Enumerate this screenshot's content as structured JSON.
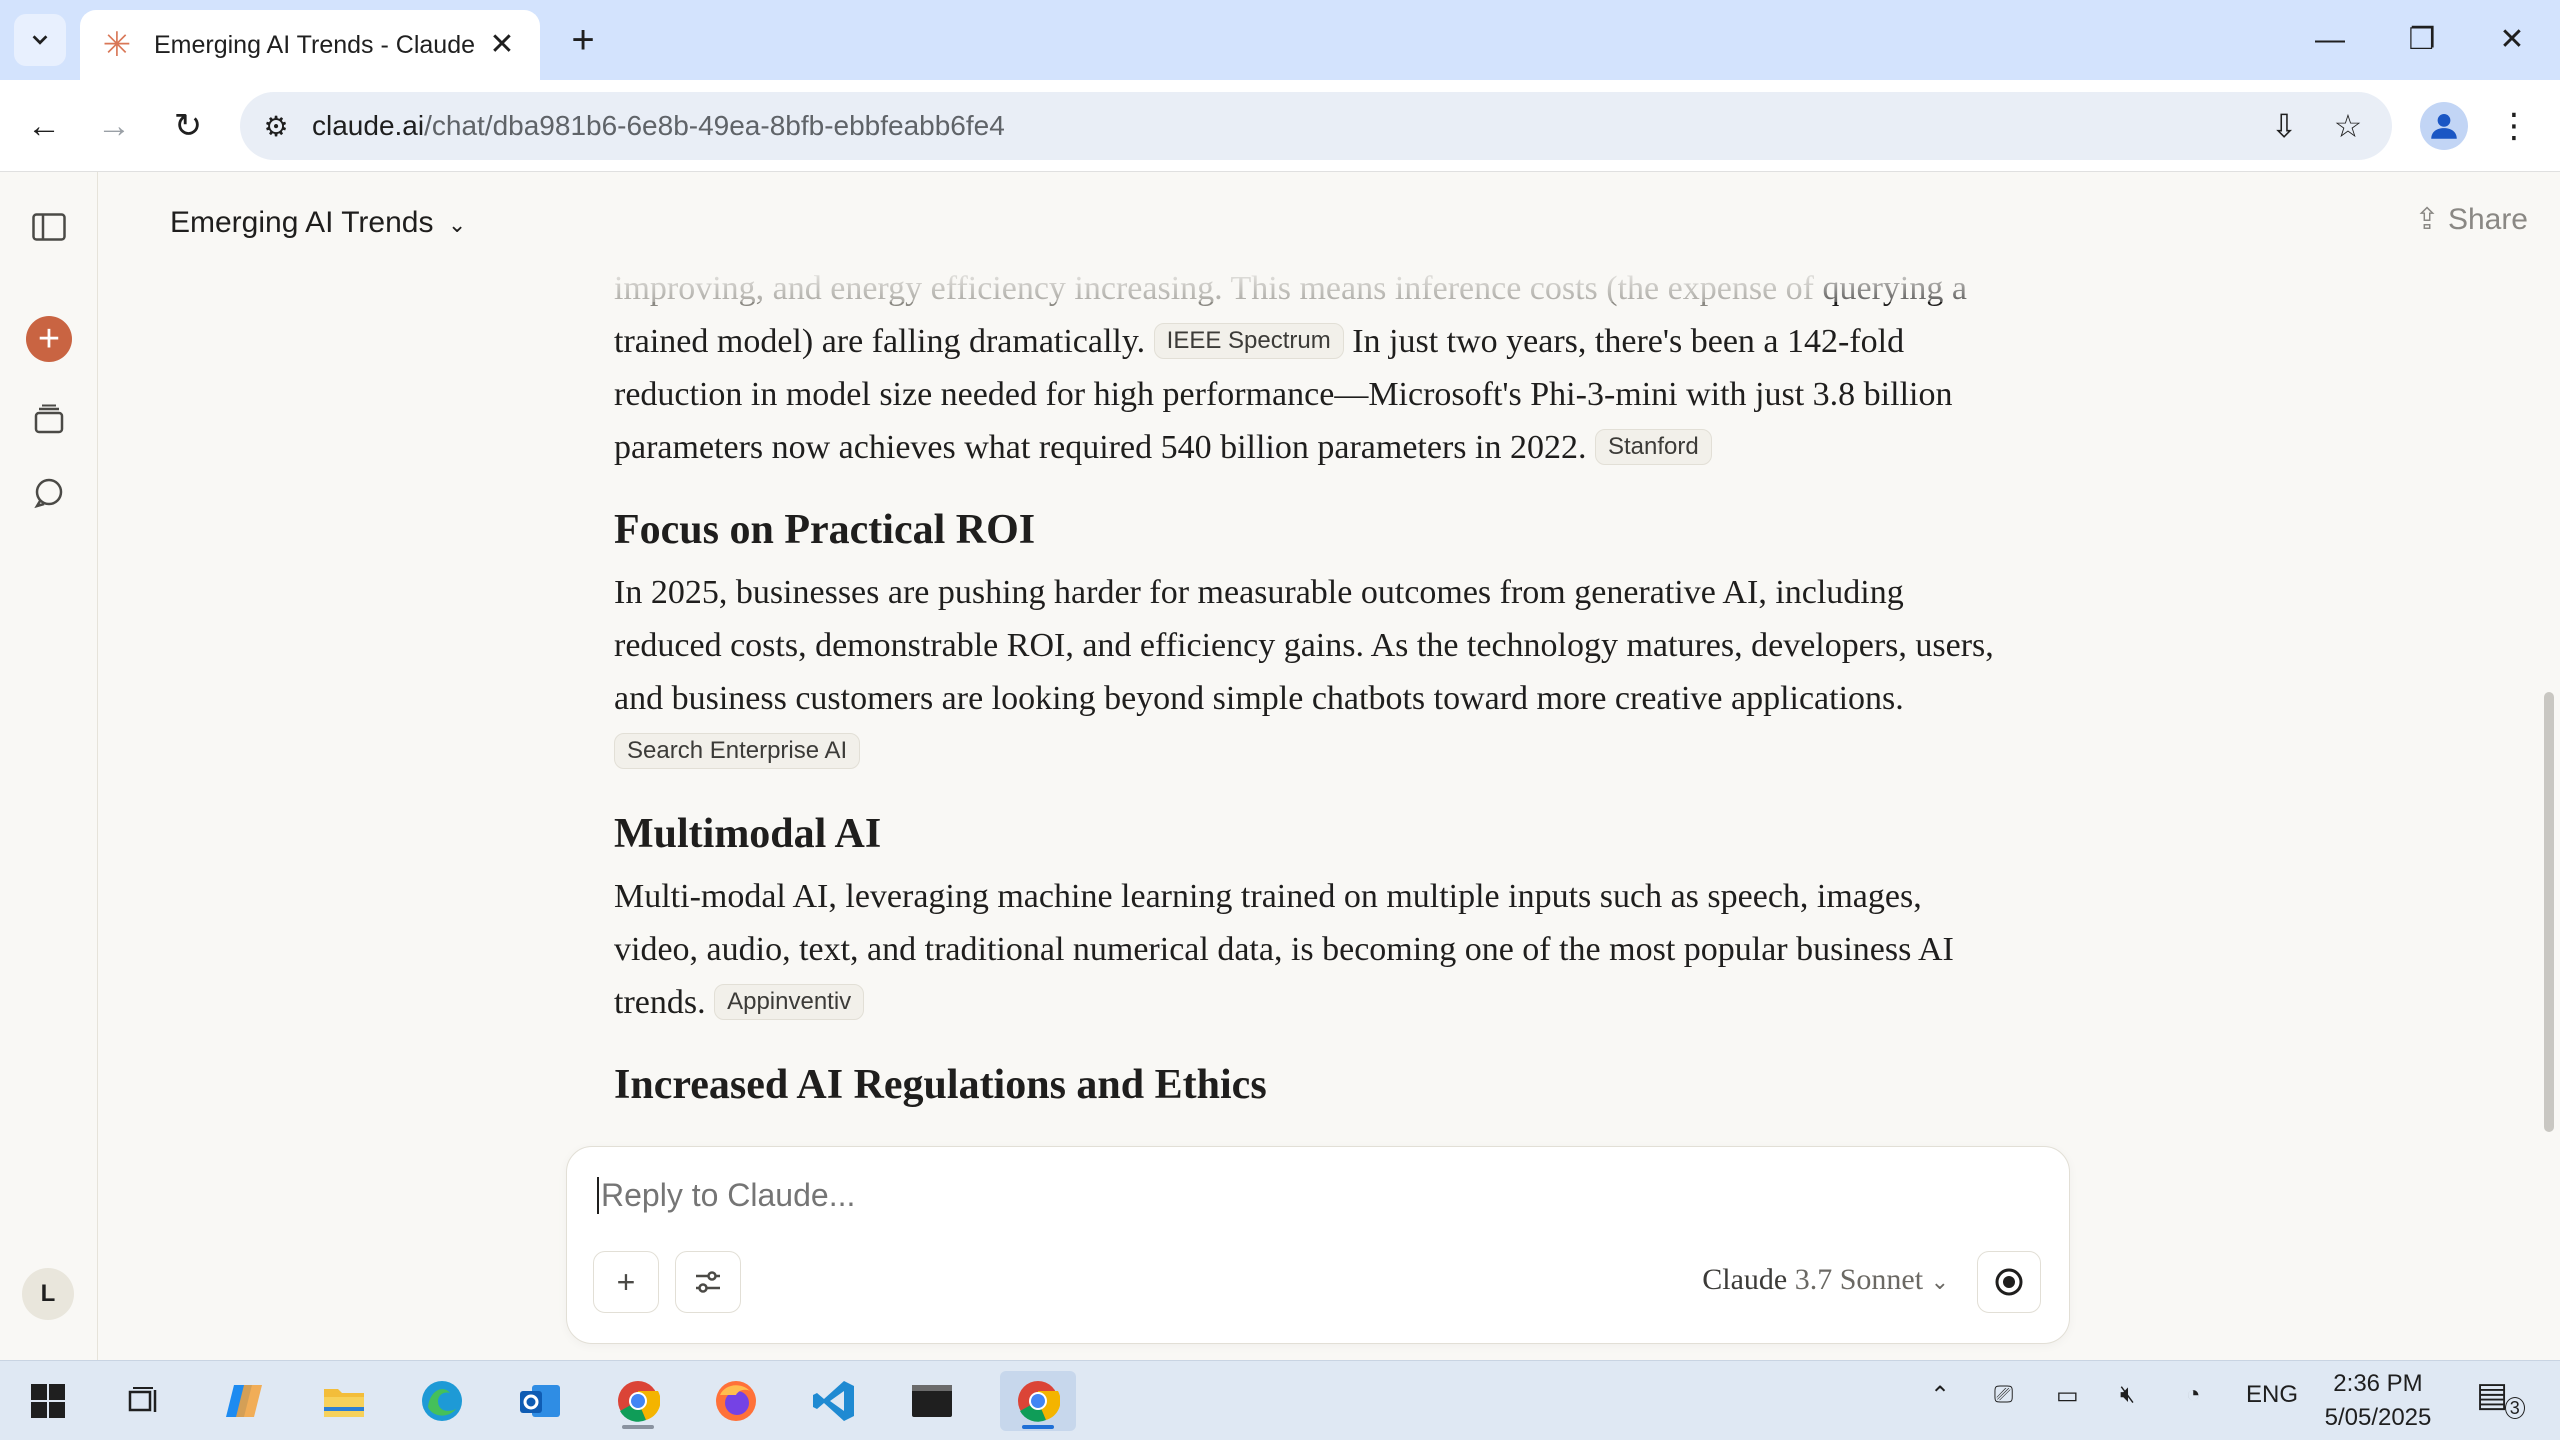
{
  "browser": {
    "tab_title": "Emerging AI Trends - Claude",
    "url_domain": "claude.ai",
    "url_path": "/chat/dba981b6-6e8b-49ea-8bfb-ebbfeabb6fe4"
  },
  "header": {
    "conversation_title": "Emerging AI Trends",
    "share_label": "Share"
  },
  "sidebar": {
    "user_initial": "L"
  },
  "content": {
    "para1_faded": "improving, and energy efficiency increasing. This means inference costs (the expense of",
    "para1_a": "querying a trained model) are falling dramatically.",
    "cite1": "IEEE Spectrum",
    "para1_b": "In just two years, there's been a 142-fold reduction in model size needed for high performance—Microsoft's Phi-3-mini with just 3.8 billion parameters now achieves what required 540 billion parameters in 2022.",
    "cite2": "Stanford",
    "h_roi": "Focus on Practical ROI",
    "para_roi": "In 2025, businesses are pushing harder for measurable outcomes from generative AI, including reduced costs, demonstrable ROI, and efficiency gains. As the technology matures, developers, users, and business customers are looking beyond simple chatbots toward more creative applications.",
    "cite3": "Search Enterprise AI",
    "h_multimodal": "Multimodal AI",
    "para_multimodal": "Multi-modal AI, leveraging machine learning trained on multiple inputs such as speech, images, video, audio, text, and traditional numerical data, is becoming one of the most popular business AI trends.",
    "cite4": "Appinventiv",
    "h_next": "Increased AI Regulations and Ethics"
  },
  "composer": {
    "placeholder": "Reply to Claude...",
    "model_name": "Claude",
    "model_version": "3.7",
    "model_variant": "Sonnet"
  },
  "taskbar": {
    "language": "ENG",
    "time": "2:36 PM",
    "date": "5/05/2025",
    "notification_count": "3"
  },
  "colors": {
    "accent": "#c96442",
    "tab_bar": "#d3e3fd",
    "page_bg": "#f9f8f5"
  }
}
